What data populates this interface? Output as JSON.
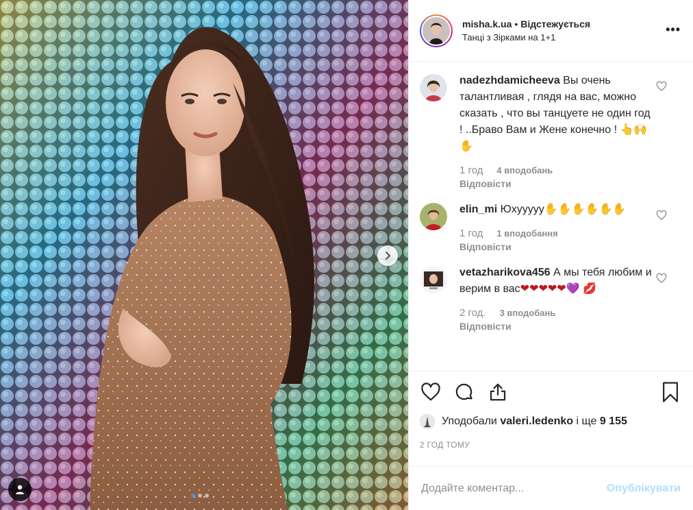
{
  "colors": {
    "accent": "#3897f0",
    "muted": "#8e8e8e",
    "text": "#262626",
    "publish_disabled": "#b2dffc",
    "heart_red": "#c0171f"
  },
  "media": {
    "carousel": {
      "slide_count": 3,
      "active_index": 0
    },
    "next_icon": "chevron-right-icon",
    "tag_icon": "user-tag-icon"
  },
  "header": {
    "username": "misha.k.ua",
    "separator": "•",
    "follow_status": "Відстежується",
    "location": "Танці з Зірками на 1+1",
    "more_icon": "more-dots-icon",
    "more_label": "•••"
  },
  "comments": [
    {
      "username": "nadezhdamicheeva",
      "text": "Вы очень талантливая , глядя на вас, можно сказать , что вы танцуете не один год ! ..Браво Вам и Жене конечно ! ",
      "emoji": "👆🙌✋",
      "time": "1 год",
      "likes": "4 вподобань",
      "reply": "Відповісти"
    },
    {
      "username": "elin_mi",
      "text": "Юхууууу",
      "emoji": "✋✋✋✋✋✋",
      "time": "1 год",
      "likes": "1 вподобання",
      "reply": "Відповісти"
    },
    {
      "username": "vetazharikova456",
      "text": "А мы тебя любим и верим в вас",
      "emoji": "❤❤❤❤❤💜 💋",
      "time": "2 год.",
      "likes": "3 вподобань",
      "reply": "Відповісти"
    }
  ],
  "actions": {
    "like_icon": "heart-icon",
    "comment_icon": "comment-icon",
    "share_icon": "share-icon",
    "save_icon": "bookmark-icon"
  },
  "likes": {
    "prefix": "Уподобали",
    "user": "valeri.ledenko",
    "middle": "і ще",
    "count": "9 155"
  },
  "timestamp": "2 ГОД ТОМУ",
  "add_comment": {
    "placeholder": "Додайте коментар...",
    "publish_label": "Опублікувати"
  }
}
